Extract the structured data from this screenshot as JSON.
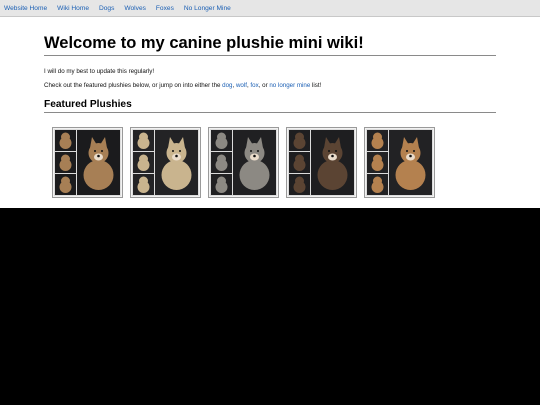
{
  "nav": {
    "items": [
      "Website Home",
      "Wiki Home",
      "Dogs",
      "Wolves",
      "Foxes",
      "No Longer Mine"
    ]
  },
  "main": {
    "title": "Welcome to my canine plushie mini wiki!",
    "intro": "I will do my best to update this regularly!",
    "links_sentence": {
      "prefix": "Check out the featured plushies below, or jump on into either the ",
      "dog": "dog",
      "sep1": ", ",
      "wolf": "wolf",
      "sep2": ", ",
      "fox": "fox",
      "sep3": ", or ",
      "no_longer_mine": "no longer mine",
      "suffix": " list!"
    },
    "featured_heading": "Featured Plushies"
  },
  "featured_plushies": [
    {
      "icon": "plush-collage-image",
      "main_color": "#a77f55",
      "bg": "#1b1b1d"
    },
    {
      "icon": "plush-collage-image",
      "main_color": "#c9b48e",
      "bg": "#232325"
    },
    {
      "icon": "plush-collage-image",
      "main_color": "#8c8983",
      "bg": "#202022"
    },
    {
      "icon": "plush-collage-image",
      "main_color": "#5b4433",
      "bg": "#1e1e20"
    },
    {
      "icon": "plush-collage-image",
      "main_color": "#b4814f",
      "bg": "#222224"
    }
  ],
  "colors": {
    "link": "#1a5fb4",
    "nav_bg": "#e6e6e6",
    "page_bg": "#ffffff",
    "below_page": "#000000"
  }
}
